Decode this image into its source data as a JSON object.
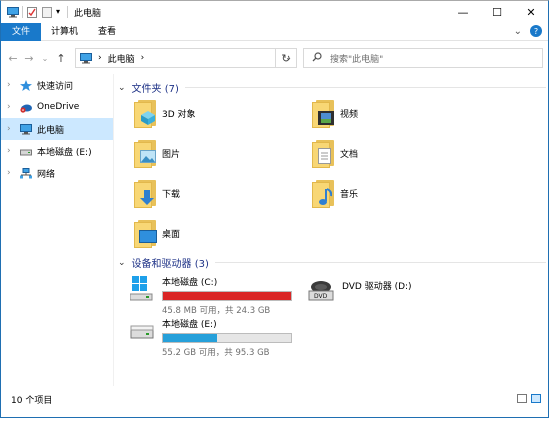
{
  "titlebar": {
    "title": "此电脑",
    "minimize": "—",
    "maximize": "☐",
    "close": "✕"
  },
  "ribbon": {
    "tabs": [
      "文件",
      "计算机",
      "查看"
    ],
    "expand": "⌄",
    "help": "?"
  },
  "nav": {
    "back": "←",
    "forward": "→",
    "recent": "⌄",
    "up": "↑",
    "refresh": "↻"
  },
  "address": {
    "separator": "›",
    "location": "此电脑",
    "dropdown": "⌄"
  },
  "search": {
    "placeholder": "搜索\"此电脑\""
  },
  "sidebar": {
    "items": [
      {
        "label": "快速访问",
        "icon": "star-icon"
      },
      {
        "label": "OneDrive",
        "icon": "cloud-icon"
      },
      {
        "label": "此电脑",
        "icon": "computer-icon",
        "selected": true
      },
      {
        "label": "本地磁盘 (E:)",
        "icon": "drive-icon"
      },
      {
        "label": "网络",
        "icon": "network-icon"
      }
    ]
  },
  "folders_group": {
    "title": "文件夹 (7)"
  },
  "folders": [
    {
      "label": "3D 对象",
      "icon": "3d-objects-icon"
    },
    {
      "label": "视频",
      "icon": "video-icon"
    },
    {
      "label": "图片",
      "icon": "pictures-icon"
    },
    {
      "label": "文档",
      "icon": "documents-icon"
    },
    {
      "label": "下载",
      "icon": "download-icon"
    },
    {
      "label": "音乐",
      "icon": "music-icon"
    },
    {
      "label": "桌面",
      "icon": "desktop-icon"
    }
  ],
  "devices_group": {
    "title": "设备和驱动器 (3)"
  },
  "drives": [
    {
      "name": "本地磁盘 (C:)",
      "info": "45.8 MB 可用，共 24.3 GB",
      "used_fraction": 0.998,
      "bar_color": "#da2626",
      "icon": "windows-drive-icon"
    },
    {
      "name": "DVD 驱动器 (D:)",
      "info": "",
      "icon": "dvd-drive-icon"
    },
    {
      "name": "本地磁盘 (E:)",
      "info": "55.2 GB 可用，共 95.3 GB",
      "used_fraction": 0.42,
      "bar_color": "#26a0da",
      "icon": "drive-icon"
    }
  ],
  "status": {
    "count": "10 个项目"
  },
  "colors": {
    "accent": "#1979ca",
    "selection": "#cce8ff",
    "group_title": "#1e3287"
  }
}
